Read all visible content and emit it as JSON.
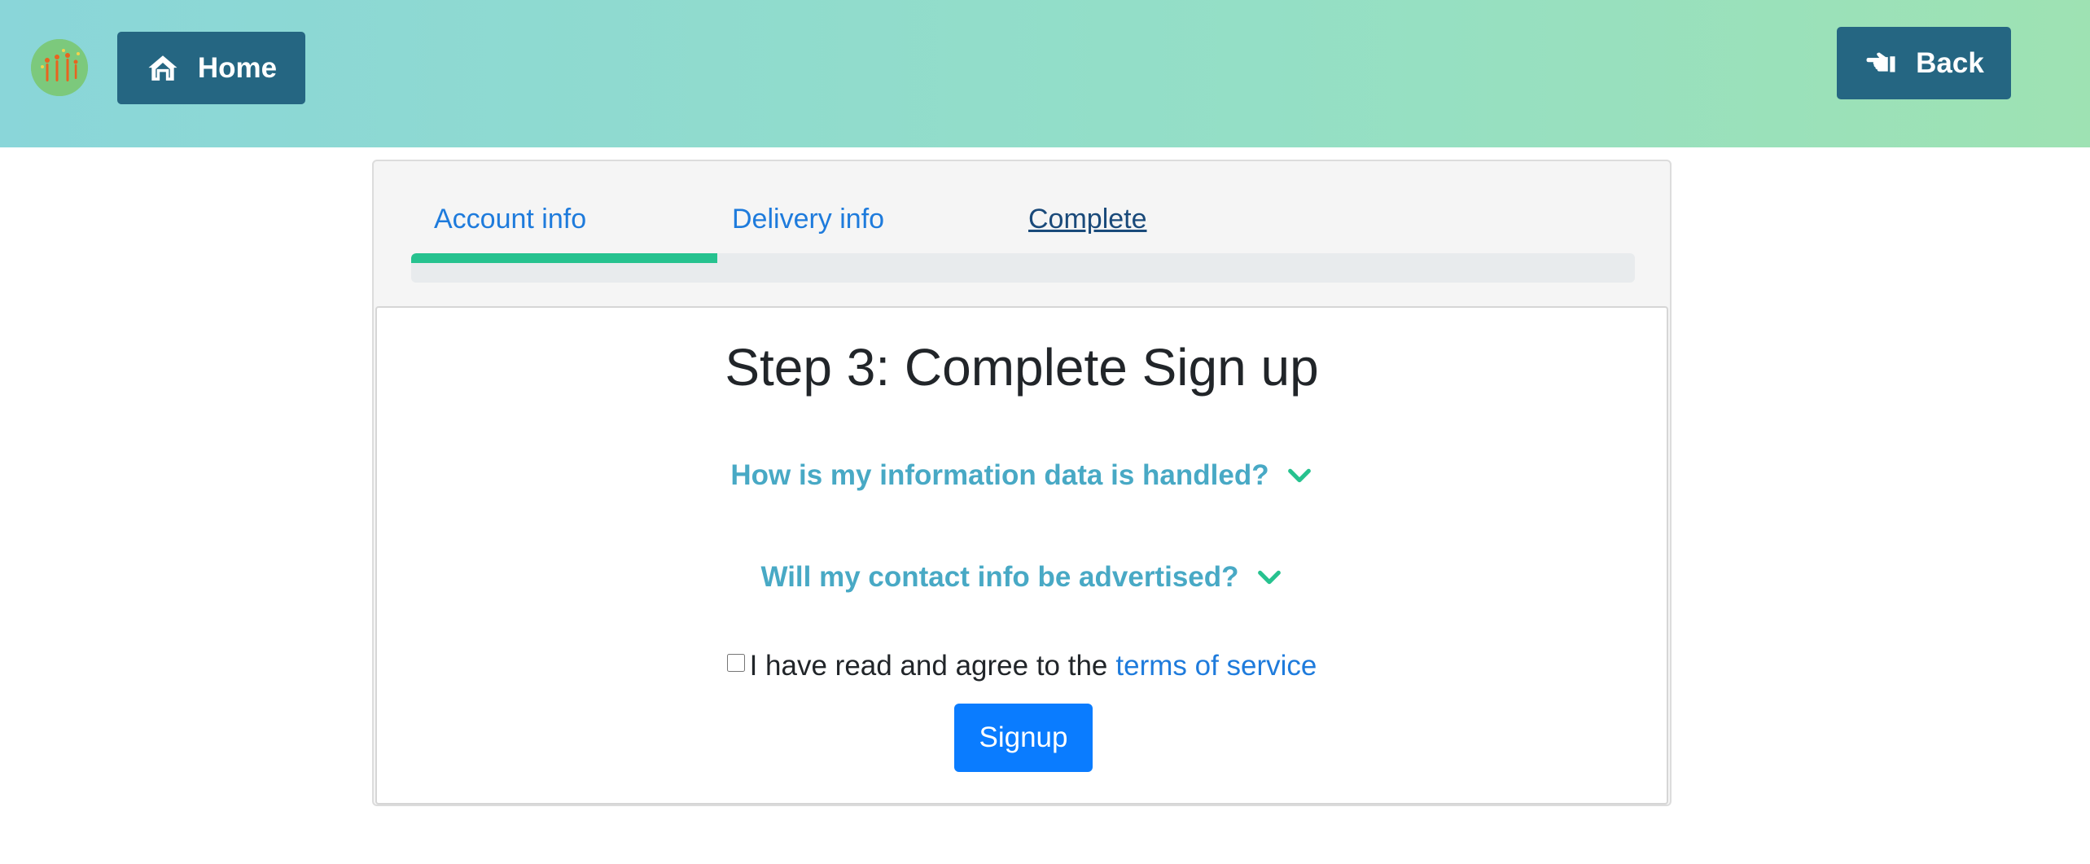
{
  "header": {
    "home_label": "Home",
    "back_label": "Back",
    "gradient_start": "#8ad6d9",
    "gradient_end": "#9ee2b3",
    "button_color": "#256682"
  },
  "wizard": {
    "steps": [
      {
        "label": "Account info"
      },
      {
        "label": "Delivery info"
      },
      {
        "label": "Complete",
        "current": true
      }
    ],
    "progress_fraction": 0.25,
    "progress_color": "#26c28f"
  },
  "content": {
    "title": "Step 3: Complete Sign up",
    "faqs": [
      {
        "question": "How is my information data is handled?",
        "icon": "chevron-down-icon"
      },
      {
        "question": "Will my contact info be advertised?",
        "icon": "chevron-down-icon"
      }
    ],
    "agree_text": "I have read and agree to the",
    "agree_link": "terms of service",
    "agree_checked": false,
    "signup_label": "Signup",
    "link_color": "#1e7bdc",
    "faq_color": "#48a9c5",
    "signup_color": "#0a7cff"
  }
}
